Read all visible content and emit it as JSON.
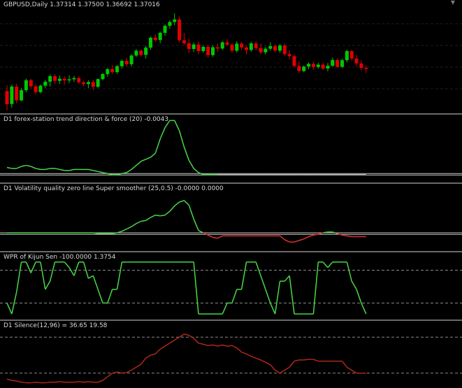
{
  "colors": {
    "background": "#000000",
    "bull_candle": "#00c800",
    "bear_candle": "#e00000",
    "indicator_up": "#48d848",
    "indicator_down": "#e03030",
    "neutral_line": "#b0b0b0",
    "zero_line": "#c8c8c8",
    "level_line": "#8a8a8a",
    "silence_line": "#b02818"
  },
  "icons": {
    "scroll_indicator": "triangle-down-icon"
  },
  "panes": {
    "price": {
      "label": "GBPUSD,Daily  1.37314 1.37500 1.36692 1.37016"
    },
    "trend": {
      "label": "D1 forex-station trend direction & force (20) -0.0043"
    },
    "volatility": {
      "label": "D1 Volatility quality zero line Super smoother (25,0.5) -0.0000 0.0000"
    },
    "wpr": {
      "label": "WPR of Kijun Sen -100.0000 1.3754"
    },
    "silence": {
      "label": "D1 Silence(12,96) =  36.65 19.58"
    }
  },
  "chart_data": [
    {
      "type": "candlestick",
      "title": "GBPUSD,Daily",
      "quote": {
        "open": 1.37314,
        "high": 1.375,
        "low": 1.36692,
        "close": 1.37016
      },
      "ylim": [
        1.366,
        1.416
      ],
      "candles": [
        [
          1.3758,
          1.3785,
          1.3668,
          1.3696
        ],
        [
          1.3697,
          1.3788,
          1.3679,
          1.3779
        ],
        [
          1.3779,
          1.3792,
          1.3701,
          1.3714
        ],
        [
          1.3714,
          1.3773,
          1.371,
          1.3762
        ],
        [
          1.3762,
          1.3817,
          1.3752,
          1.3809
        ],
        [
          1.3809,
          1.3815,
          1.3771,
          1.378
        ],
        [
          1.378,
          1.379,
          1.3742,
          1.3753
        ],
        [
          1.3753,
          1.3789,
          1.3747,
          1.3783
        ],
        [
          1.3783,
          1.3811,
          1.3772,
          1.3802
        ],
        [
          1.3802,
          1.3836,
          1.3779,
          1.3828
        ],
        [
          1.3828,
          1.3837,
          1.379,
          1.3806
        ],
        [
          1.3806,
          1.3831,
          1.3792,
          1.3816
        ],
        [
          1.3816,
          1.3827,
          1.3787,
          1.3808
        ],
        [
          1.3808,
          1.3832,
          1.3795,
          1.3813
        ],
        [
          1.3813,
          1.3829,
          1.3801,
          1.3819
        ],
        [
          1.3819,
          1.3827,
          1.3793,
          1.3799
        ],
        [
          1.3799,
          1.3806,
          1.3781,
          1.3791
        ],
        [
          1.3791,
          1.3808,
          1.3772,
          1.38
        ],
        [
          1.38,
          1.3811,
          1.3762,
          1.3778
        ],
        [
          1.3778,
          1.3818,
          1.3772,
          1.3814
        ],
        [
          1.3814,
          1.3843,
          1.3808,
          1.3838
        ],
        [
          1.3838,
          1.3867,
          1.3825,
          1.3861
        ],
        [
          1.3861,
          1.388,
          1.3838,
          1.3847
        ],
        [
          1.3847,
          1.3881,
          1.3838,
          1.3875
        ],
        [
          1.3875,
          1.3906,
          1.3864,
          1.39
        ],
        [
          1.39,
          1.3915,
          1.3872,
          1.3884
        ],
        [
          1.3884,
          1.3931,
          1.3873,
          1.3925
        ],
        [
          1.3925,
          1.3956,
          1.3918,
          1.3948
        ],
        [
          1.3948,
          1.3953,
          1.3921,
          1.3928
        ],
        [
          1.3928,
          1.3971,
          1.3911,
          1.3962
        ],
        [
          1.3962,
          1.4015,
          1.3951,
          1.4009
        ],
        [
          1.4009,
          1.4025,
          1.399,
          1.3998
        ],
        [
          1.3998,
          1.4038,
          1.3983,
          1.4032
        ],
        [
          1.4032,
          1.4072,
          1.4018,
          1.4065
        ],
        [
          1.4065,
          1.4092,
          1.4051,
          1.4083
        ],
        [
          1.4083,
          1.4123,
          1.4067,
          1.4095
        ],
        [
          1.4095,
          1.4108,
          1.3987,
          1.3997
        ],
        [
          1.3997,
          1.4031,
          1.3973,
          1.3983
        ],
        [
          1.3983,
          1.4004,
          1.3937,
          1.3956
        ],
        [
          1.3956,
          1.3987,
          1.3942,
          1.3977
        ],
        [
          1.3977,
          1.3992,
          1.3931,
          1.3946
        ],
        [
          1.3946,
          1.3972,
          1.3938,
          1.3966
        ],
        [
          1.3966,
          1.3975,
          1.3915,
          1.3927
        ],
        [
          1.3927,
          1.3974,
          1.3918,
          1.3964
        ],
        [
          1.3964,
          1.3982,
          1.3942,
          1.3958
        ],
        [
          1.3958,
          1.3994,
          1.3951,
          1.3987
        ],
        [
          1.3987,
          1.4002,
          1.3969,
          1.3976
        ],
        [
          1.3976,
          1.3982,
          1.3938,
          1.3948
        ],
        [
          1.3948,
          1.3993,
          1.3939,
          1.3981
        ],
        [
          1.3981,
          1.3989,
          1.3951,
          1.3963
        ],
        [
          1.3963,
          1.3971,
          1.3931,
          1.3951
        ],
        [
          1.3951,
          1.3989,
          1.3944,
          1.3982
        ],
        [
          1.3982,
          1.3992,
          1.3948,
          1.396
        ],
        [
          1.396,
          1.3981,
          1.3931,
          1.394
        ],
        [
          1.394,
          1.3965,
          1.3929,
          1.3957
        ],
        [
          1.3957,
          1.3988,
          1.3948,
          1.3969
        ],
        [
          1.3969,
          1.3977,
          1.394,
          1.3948
        ],
        [
          1.3948,
          1.3979,
          1.3938,
          1.3972
        ],
        [
          1.3972,
          1.3982,
          1.3923,
          1.3932
        ],
        [
          1.3932,
          1.3951,
          1.3908,
          1.3922
        ],
        [
          1.3922,
          1.3931,
          1.387,
          1.3876
        ],
        [
          1.3876,
          1.3897,
          1.3842,
          1.3852
        ],
        [
          1.3852,
          1.3878,
          1.3847,
          1.3873
        ],
        [
          1.3873,
          1.3893,
          1.3861,
          1.3886
        ],
        [
          1.3886,
          1.3897,
          1.3858,
          1.3871
        ],
        [
          1.3871,
          1.3891,
          1.3863,
          1.3882
        ],
        [
          1.3882,
          1.3893,
          1.3857,
          1.3864
        ],
        [
          1.3864,
          1.389,
          1.3851,
          1.3877
        ],
        [
          1.3877,
          1.3915,
          1.3872,
          1.3904
        ],
        [
          1.3904,
          1.3911,
          1.3868,
          1.3872
        ],
        [
          1.3872,
          1.391,
          1.3867,
          1.3903
        ],
        [
          1.3903,
          1.3953,
          1.3894,
          1.3946
        ],
        [
          1.3946,
          1.3951,
          1.3901,
          1.3911
        ],
        [
          1.3911,
          1.3929,
          1.3872,
          1.3888
        ],
        [
          1.3888,
          1.3901,
          1.3856,
          1.3867
        ],
        [
          1.3867,
          1.3879,
          1.3843,
          1.3862
        ]
      ]
    },
    {
      "type": "line",
      "title": "D1 forex-station trend direction & force (20)",
      "values_shown": [
        -0.0043
      ],
      "ylim": [
        -0.06,
        0.55
      ],
      "levels": [
        0,
        -0.015
      ],
      "series": [
        {
          "values": [
            0.06,
            0.05,
            0.05,
            0.07,
            0.08,
            0.07,
            0.05,
            0.04,
            0.04,
            0.05,
            0.05,
            0.04,
            0.03,
            0.03,
            0.04,
            0.04,
            0.04,
            0.04,
            0.03,
            0.02,
            0.01,
            0.0,
            -0.01,
            -0.01,
            0.0,
            0.01,
            0.04,
            0.08,
            0.12,
            0.14,
            0.16,
            0.2,
            0.34,
            0.45,
            0.52,
            0.52,
            0.42,
            0.26,
            0.13,
            0.05,
            0.01,
            -0.01,
            -0.01,
            -0.01,
            -0.01,
            -0.01,
            -0.01,
            -0.01,
            -0.01,
            -0.01,
            -0.01,
            -0.01,
            -0.01,
            -0.01,
            -0.01,
            -0.01,
            -0.01,
            -0.01,
            -0.01,
            -0.01,
            -0.01,
            -0.01,
            -0.01,
            -0.01,
            -0.01,
            -0.01,
            -0.01,
            -0.01,
            -0.01,
            -0.01,
            -0.01,
            -0.01,
            -0.01,
            -0.01,
            -0.01,
            -0.01
          ]
        }
      ]
    },
    {
      "type": "line",
      "title": "D1 Volatility quality zero line Super smoother (25,0.5)",
      "values_shown": [
        -0.0,
        0.0
      ],
      "ylim": [
        -0.2,
        0.6
      ],
      "levels": [
        0,
        -0.02
      ],
      "series": [
        {
          "values": [
            0.0,
            0.0,
            0.0,
            0.0,
            0.0,
            0.0,
            0.0,
            0.0,
            0.0,
            0.0,
            0.0,
            0.0,
            0.0,
            0.0,
            0.0,
            0.0,
            0.0,
            0.0,
            0.0,
            -0.01,
            -0.01,
            -0.01,
            -0.01,
            0.0,
            0.02,
            0.05,
            0.08,
            0.12,
            0.15,
            0.16,
            0.2,
            0.23,
            0.22,
            0.23,
            0.28,
            0.35,
            0.4,
            0.42,
            0.36,
            0.18,
            0.03,
            0.0,
            -0.03,
            -0.06,
            -0.07,
            -0.04,
            -0.04,
            -0.04,
            -0.04,
            -0.04,
            -0.04,
            -0.04,
            -0.04,
            -0.04,
            -0.04,
            -0.04,
            -0.04,
            -0.04,
            -0.09,
            -0.12,
            -0.12,
            -0.1,
            -0.08,
            -0.05,
            -0.03,
            -0.02,
            0.0,
            0.01,
            0.01,
            -0.01,
            -0.03,
            -0.04,
            -0.05,
            -0.05,
            -0.05,
            -0.05
          ]
        }
      ]
    },
    {
      "type": "line",
      "title": "WPR of Kijun Sen",
      "values_shown": [
        -100.0,
        1.3754
      ],
      "ylim": [
        -105,
        5
      ],
      "levels": [
        -20,
        -80
      ],
      "series": [
        {
          "values": [
            -80,
            -100,
            -60,
            -5,
            -5,
            -25,
            -5,
            -5,
            -55,
            -40,
            -5,
            -5,
            -5,
            -15,
            -30,
            -5,
            -5,
            -35,
            -30,
            -55,
            -80,
            -80,
            -55,
            -55,
            -5,
            -5,
            -5,
            -5,
            -5,
            -5,
            -5,
            -5,
            -5,
            -5,
            -5,
            -5,
            -5,
            -5,
            -5,
            -5,
            -100,
            -100,
            -100,
            -100,
            -100,
            -100,
            -80,
            -80,
            -55,
            -55,
            -5,
            -5,
            -5,
            -30,
            -55,
            -80,
            -100,
            -40,
            -40,
            -30,
            -100,
            -100,
            -100,
            -100,
            -100,
            -5,
            -5,
            -15,
            -5,
            -5,
            -5,
            -5,
            -40,
            -55,
            -80,
            -100
          ]
        }
      ]
    },
    {
      "type": "line",
      "title": "D1 Silence(12,96)",
      "values_shown": [
        36.65,
        19.58
      ],
      "ylim": [
        0,
        100
      ],
      "levels": [
        80,
        20
      ],
      "series": [
        {
          "values": [
            10,
            8,
            7,
            5,
            4,
            4,
            5,
            4,
            4,
            5,
            5,
            6,
            5,
            5,
            5,
            6,
            5,
            6,
            5,
            5,
            8,
            14,
            20,
            22,
            20,
            21,
            25,
            30,
            35,
            45,
            50,
            52,
            60,
            65,
            70,
            75,
            80,
            85,
            83,
            78,
            70,
            68,
            66,
            67,
            65,
            67,
            65,
            66,
            62,
            55,
            52,
            48,
            45,
            42,
            38,
            34,
            25,
            20,
            25,
            30,
            40,
            42,
            42,
            43,
            43,
            40,
            40,
            40,
            40,
            40,
            40,
            30,
            25,
            20,
            20,
            20
          ]
        }
      ]
    }
  ]
}
